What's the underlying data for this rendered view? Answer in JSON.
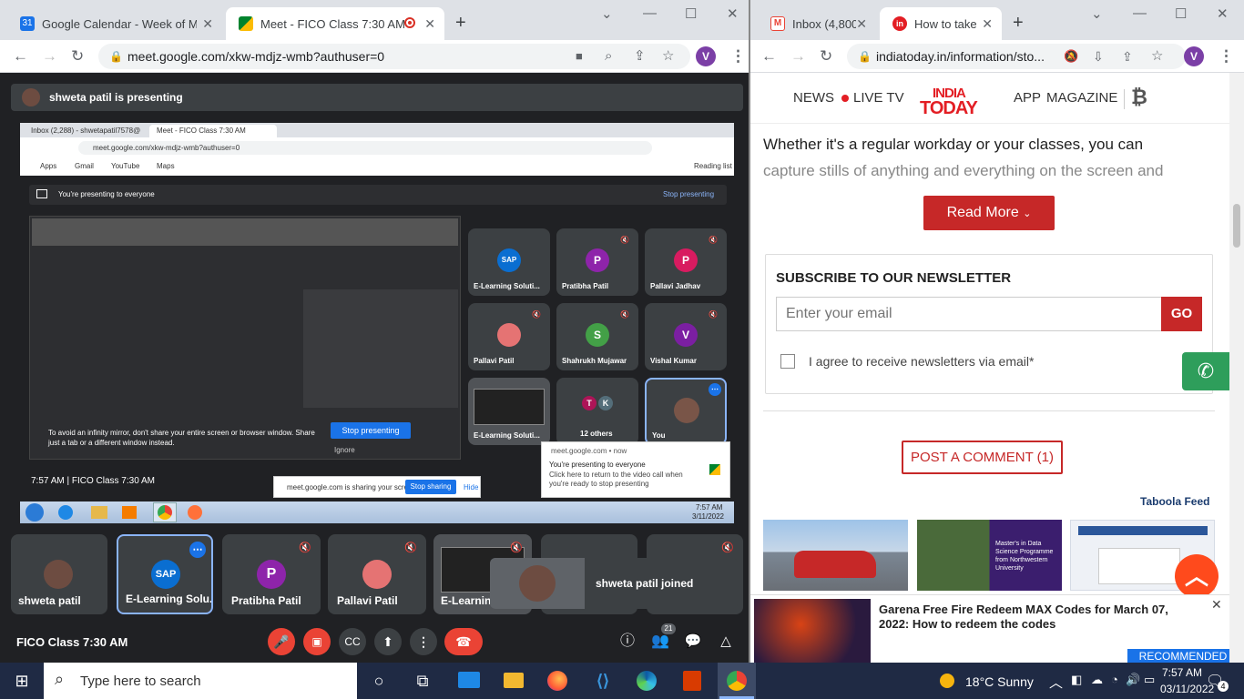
{
  "left_browser": {
    "tabs": [
      {
        "title": "Google Calendar - Week of Marc",
        "icon": "calendar-icon"
      },
      {
        "title": "Meet - FICO Class 7:30 AM",
        "icon": "meet-icon"
      }
    ],
    "url": "meet.google.com/xkw-mdjz-wmb?authuser=0",
    "profile_initial": "V"
  },
  "meet": {
    "presenting_banner": "shweta patil is presenting",
    "shared_screen": {
      "mini_tabs": [
        "Inbox (2,288) - shwetapatil7578@",
        "Meet - FICO Class 7:30 AM"
      ],
      "mini_url": "meet.google.com/xkw-mdjz-wmb?authuser=0",
      "bookmarks": [
        "Apps",
        "Gmail",
        "YouTube",
        "Maps"
      ],
      "reading_list": "Reading list",
      "presenting_to": "You're presenting to everyone",
      "stop_presenting_link": "Stop presenting",
      "infinity_warning": "To avoid an infinity mirror, don't share your entire screen or browser window. Share just a tab or a different window instead.",
      "stop_presenting_button": "Stop presenting",
      "ignore": "Ignore",
      "time_meeting": "7:57 AM | FICO Class 7:30 AM",
      "grid": [
        {
          "name": "E-Learning Soluti...",
          "avatar": "SAP",
          "color": "#0a6ed1"
        },
        {
          "name": "Pratibha Patil",
          "avatar": "P",
          "color": "#8e24aa"
        },
        {
          "name": "Pallavi Jadhav",
          "avatar": "P",
          "color": "#d81b60"
        },
        {
          "name": "Pallavi Patil",
          "avatar": "",
          "color": "#e57373"
        },
        {
          "name": "Shahrukh Mujawar",
          "avatar": "S",
          "color": "#43a047"
        },
        {
          "name": "Vishal Kumar",
          "avatar": "V",
          "color": "#7b1fa2"
        },
        {
          "name": "E-Learning Soluti...",
          "avatar": "",
          "color": "#555"
        },
        {
          "name": "12 others",
          "avatar": "TK",
          "color": "#616161"
        },
        {
          "name": "You",
          "avatar": "",
          "color": "#795548"
        }
      ],
      "sharing_bar_text": "meet.google.com is sharing your screen.",
      "sharing_bar_stop": "Stop sharing",
      "sharing_bar_hide": "Hide",
      "notification_source": "meet.google.com • now",
      "notification_title": "You're presenting to everyone",
      "notification_body": "Click here to return to the video call when you're ready to stop presenting",
      "mini_clock_time": "7:57 AM",
      "mini_clock_date": "3/11/2022"
    },
    "bottom_tiles": [
      {
        "name": "shweta patil"
      },
      {
        "name": "E-Learning Solu..."
      },
      {
        "name": "Pratibha Patil",
        "avatar": "P"
      },
      {
        "name": "Pallavi Patil"
      },
      {
        "name": "E-Learning"
      }
    ],
    "toast": "shweta patil joined",
    "meeting_name": "FICO Class 7:30 AM",
    "participants_count": "21"
  },
  "right_browser": {
    "tabs": [
      {
        "title": "Inbox (4,800)",
        "icon": "gmail-icon"
      },
      {
        "title": "How to take",
        "icon": "indiatoday-icon"
      }
    ],
    "url": "indiatoday.in/information/sto...",
    "profile_initial": "V",
    "site_nav": {
      "news": "NEWS",
      "live": "LIVE TV",
      "logo_top": "INDIA",
      "logo_bottom": "TODAY",
      "app": "APP",
      "magazine": "MAGAZINE"
    },
    "article_line1": "Whether it's a regular workday or your classes, you can",
    "article_line2": "capture stills of anything and everything on the screen and",
    "read_more": "Read More",
    "newsletter_title": "SUBSCRIBE TO OUR NEWSLETTER",
    "email_placeholder": "Enter your email",
    "go": "GO",
    "agree": "I agree to receive newsletters via email*",
    "post_comment": "POST A COMMENT (1)",
    "taboola": "Taboola Feed",
    "thumb3_caption": "Master's in Data Science Programme from Northwestern University",
    "recommended_title": "Garena Free Fire Redeem MAX Codes for March 07, 2022: How to redeem the codes",
    "recommended_badge": "RECOMMENDED"
  },
  "taskbar": {
    "search_placeholder": "Type here to search",
    "weather": "18°C  Sunny",
    "time": "7:57 AM",
    "date": "03/11/2022",
    "notifications": "4"
  }
}
